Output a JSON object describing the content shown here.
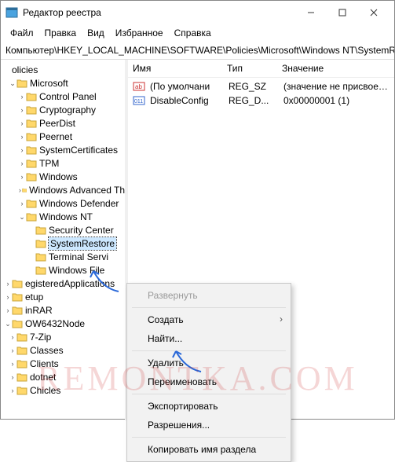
{
  "window": {
    "title": "Редактор реестра"
  },
  "menu": {
    "file": "Файл",
    "edit": "Правка",
    "view": "Вид",
    "favorites": "Избранное",
    "help": "Справка"
  },
  "path": "Компьютер\\HKEY_LOCAL_MACHINE\\SOFTWARE\\Policies\\Microsoft\\Windows NT\\SystemRe",
  "tree": {
    "root": "olicies",
    "microsoft": "Microsoft",
    "items1": [
      "Control Panel",
      "Cryptography",
      "PeerDist",
      "Peernet",
      "SystemCertificates",
      "TPM",
      "Windows",
      "Windows Advanced Th",
      "Windows Defender"
    ],
    "winNT": "Windows NT",
    "ntChildren": [
      "Security Center",
      "SystemRestore",
      "Terminal Servi",
      "Windows File"
    ],
    "tail": [
      "egisteredApplications",
      "etup",
      "inRAR",
      "OW6432Node"
    ],
    "wow": [
      "7-Zip",
      "Classes",
      "Clients",
      "dotnet",
      "Chicles"
    ]
  },
  "columns": {
    "name": "Имя",
    "type": "Тип",
    "value": "Значение"
  },
  "rows": [
    {
      "icon": "ab",
      "name": "(По умолчани",
      "type": "REG_SZ",
      "value": "(значение не присвоено)"
    },
    {
      "icon": "bin",
      "name": "DisableConfig",
      "type": "REG_D...",
      "value": "0x00000001 (1)"
    }
  ],
  "contextMenu": {
    "expand": "Развернуть",
    "create": "Создать",
    "find": "Найти...",
    "delete": "Удалить",
    "rename": "Переименовать",
    "export": "Экспортировать",
    "perms": "Разрешения...",
    "copyKey": "Копировать имя раздела"
  },
  "watermark": "REMONTKA.COM"
}
